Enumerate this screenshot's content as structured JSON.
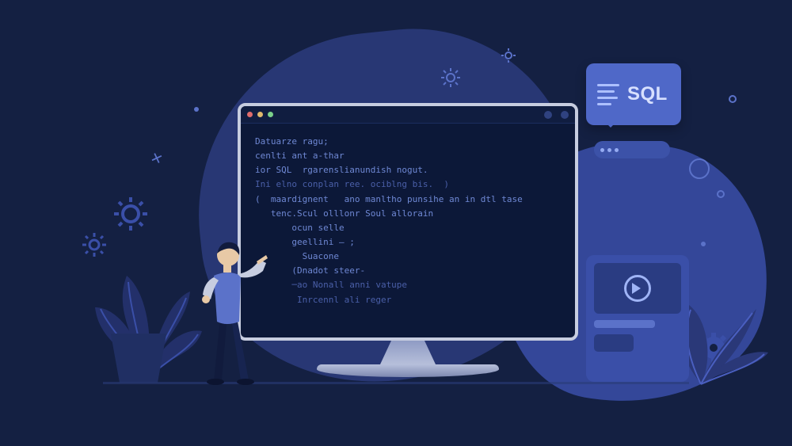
{
  "sql_card": {
    "label": "SQL"
  },
  "code": {
    "lines": [
      "Datuarze ragu;",
      "cenlti ant a-thar",
      "ior SQL  rgarenslianundish nogut.",
      "Ini elno conplan ree. ociblng bis.  )",
      "(  maardignent   ano manltho punsihe an in dtl tase",
      "   tenc.Scul olllonr Soul allorain",
      "       ocun selle",
      "       geellini — ;",
      "         Suacone",
      "       (Dnadot steer-",
      "       ─ao Nonall anni vatupe",
      "        Inrcennl ali reger"
    ],
    "highlight_line_index": 3,
    "highlight2_line_index": 6
  },
  "colors": {
    "bg": "#142042",
    "blob_dark": "#2a3a7a",
    "blob_mid": "#3a4fa8",
    "accent": "#4f68c8",
    "yellow": "#f0b24a"
  }
}
